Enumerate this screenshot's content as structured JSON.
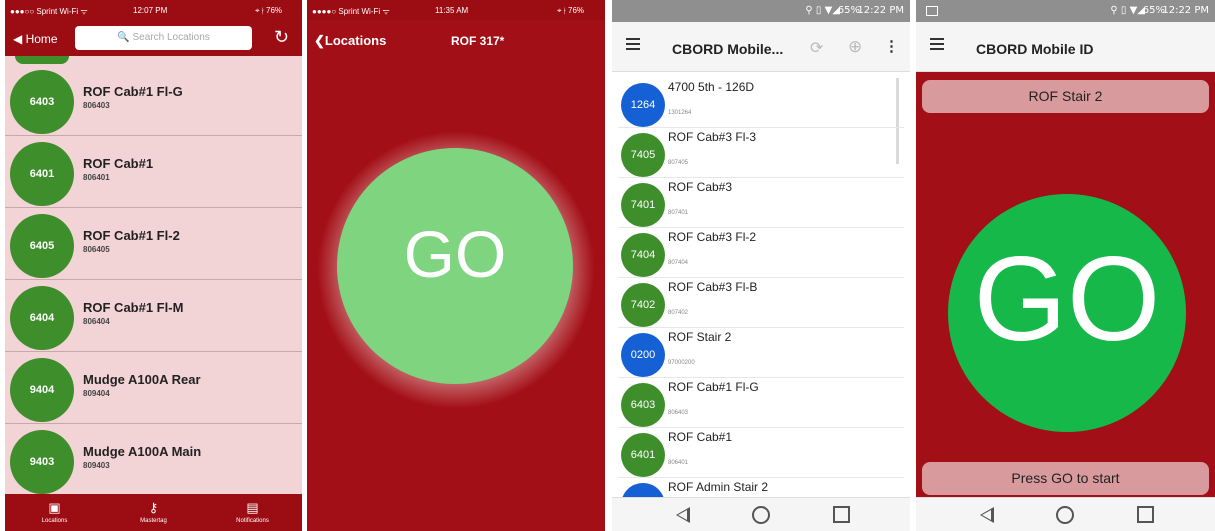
{
  "screen1": {
    "status": {
      "carrier": "●●●○○ Sprint Wi-Fi ᯤ",
      "time": "12:07 PM",
      "battery": "⌖ ∤ 76%"
    },
    "nav": {
      "home_label": "◀ Home",
      "search_placeholder": "🔍 Search Locations"
    },
    "locations": [
      {
        "code": "6403",
        "name": "ROF Cab#1 Fl-G",
        "id": "806403"
      },
      {
        "code": "6401",
        "name": "ROF Cab#1",
        "id": "806401"
      },
      {
        "code": "6405",
        "name": "ROF Cab#1 Fl-2",
        "id": "806405"
      },
      {
        "code": "6404",
        "name": "ROF Cab#1 Fl-M",
        "id": "806404"
      },
      {
        "code": "9404",
        "name": "Mudge A100A Rear",
        "id": "809404"
      },
      {
        "code": "9403",
        "name": "Mudge A100A Main",
        "id": "809403"
      }
    ],
    "tabs": [
      {
        "label": "Locations",
        "icon": "location-card-icon"
      },
      {
        "label": "Mastertag",
        "icon": "key-icon"
      },
      {
        "label": "Notifications",
        "icon": "document-icon"
      }
    ]
  },
  "screen2": {
    "status": {
      "carrier": "●●●●○ Sprint Wi-Fi ᯤ",
      "time": "11:35 AM",
      "battery": "⌖ ∤ 76%"
    },
    "back_label": "Locations",
    "title": "ROF 317*",
    "go_label": "GO"
  },
  "screen3": {
    "status_time": "12:22 PM",
    "status_battery": "65%",
    "app_title": "CBORD Mobile...",
    "locations": [
      {
        "code": "1264",
        "name": "4700 5th - 126D",
        "id": "1301264",
        "color": "#1460d4"
      },
      {
        "code": "7405",
        "name": "ROF Cab#3 Fl-3",
        "id": "807405",
        "color": "#3e8e2c"
      },
      {
        "code": "7401",
        "name": "ROF Cab#3",
        "id": "807401",
        "color": "#3e8e2c"
      },
      {
        "code": "7404",
        "name": "ROF Cab#3 Fl-2",
        "id": "807404",
        "color": "#3e8e2c"
      },
      {
        "code": "7402",
        "name": "ROF Cab#3 Fl-B",
        "id": "807402",
        "color": "#3e8e2c"
      },
      {
        "code": "0200",
        "name": "ROF Stair 2",
        "id": "97000200",
        "color": "#1460d4"
      },
      {
        "code": "6403",
        "name": "ROF Cab#1 Fl-G",
        "id": "806403",
        "color": "#3e8e2c"
      },
      {
        "code": "6401",
        "name": "ROF Cab#1",
        "id": "806401",
        "color": "#3e8e2c"
      },
      {
        "code": "",
        "name": "ROF Admin Stair 2",
        "id": "",
        "color": "#1460d4"
      }
    ]
  },
  "screen4": {
    "status_time": "12:22 PM",
    "status_battery": "65%",
    "app_title": "CBORD Mobile ID",
    "location_name": "ROF Stair 2",
    "go_label": "GO",
    "hint": "Press GO to start"
  }
}
